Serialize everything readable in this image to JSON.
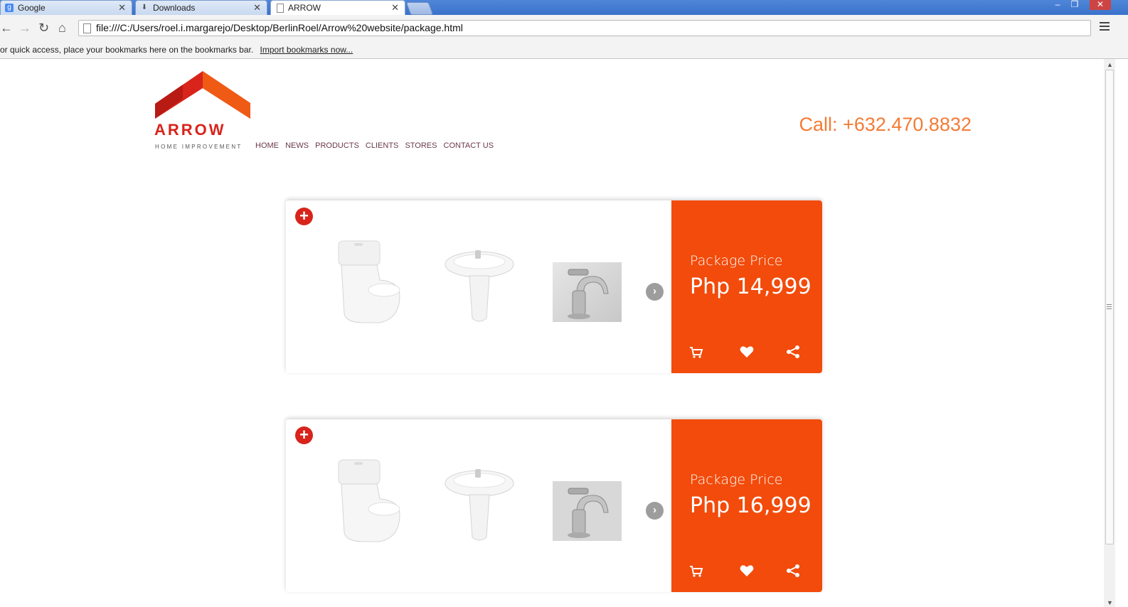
{
  "browser": {
    "tabs": [
      {
        "title": "Google",
        "icon": "google-icon"
      },
      {
        "title": "Downloads",
        "icon": "download-icon"
      },
      {
        "title": "ARROW",
        "icon": "page-icon"
      }
    ],
    "close_glyph": "✕",
    "url": "file:///C:/Users/roel.i.margarejo/Desktop/BerlinRoel/Arrow%20website/package.html",
    "bookmarks_text": "or quick access, place your bookmarks here on the bookmarks bar.",
    "bookmarks_link": "Import bookmarks now..."
  },
  "site": {
    "logo_word": "ARROW",
    "logo_tagline": "HOME IMPROVEMENT",
    "nav": [
      "HOME",
      "NEWS",
      "PRODUCTS",
      "CLIENTS",
      "STORES",
      "CONTACT US"
    ],
    "call": "Call: +632.470.8832",
    "brand_color": "#f24b0b",
    "logo_color": "#d8241b"
  },
  "packages": [
    {
      "price_label": "Package Price",
      "price": "Php 14,999",
      "items": [
        "toilet",
        "pedestal-sink",
        "faucet"
      ]
    },
    {
      "price_label": "Package Price",
      "price": "Php 16,999",
      "items": [
        "toilet",
        "pedestal-sink",
        "faucet"
      ]
    }
  ]
}
